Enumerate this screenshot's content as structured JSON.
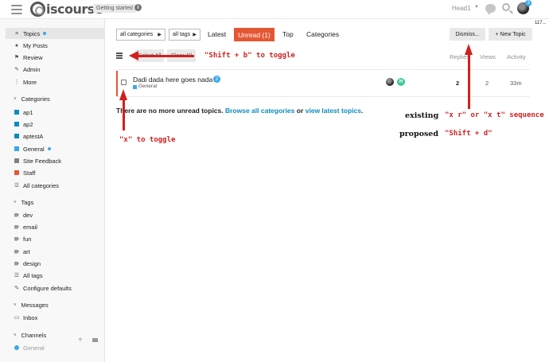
{
  "header": {
    "logo_text": "iscourse",
    "getting_started": "Getting started",
    "info_glyph": "i",
    "user_name": "Head1",
    "notification_count": "3",
    "cutoff_text": "117..."
  },
  "sidebar": {
    "top_items": [
      {
        "label": "Topics",
        "icon": "layers-icon"
      },
      {
        "label": "My Posts",
        "icon": "user-icon"
      },
      {
        "label": "Review",
        "icon": "flag-icon"
      },
      {
        "label": "Admin",
        "icon": "wrench-icon"
      },
      {
        "label": "More",
        "icon": "more-icon"
      }
    ],
    "categories_heading": "Categories",
    "categories": [
      {
        "label": "ap1",
        "color": "#0a8bbf"
      },
      {
        "label": "ap2",
        "color": "#0a8bbf"
      },
      {
        "label": "aptestA",
        "color": "#0a8bbf"
      },
      {
        "label": "General",
        "color": "#3aa8e8"
      },
      {
        "label": "Site Feedback",
        "color": "#808281"
      },
      {
        "label": "Staff",
        "color": "#e45735"
      },
      {
        "label": "All categories",
        "icon": "list-icon"
      }
    ],
    "tags_heading": "Tags",
    "tags": [
      "dev",
      "email",
      "fun",
      "art",
      "design"
    ],
    "all_tags": "All tags",
    "configure_defaults": "Configure defaults",
    "messages_heading": "Messages",
    "inbox": "Inbox",
    "channels_heading": "Channels",
    "channel_general": "General"
  },
  "main": {
    "filter_categories": "all categories",
    "filter_tags": "all tags",
    "nav": {
      "latest": "Latest",
      "unread": "Unread (1)",
      "top": "Top",
      "categories": "Categories"
    },
    "dismiss": "Dismiss...",
    "new_topic": "+ New Topic",
    "select_all": "Select All",
    "clear_all": "Clear All",
    "columns": {
      "replies": "Replies",
      "views": "Views",
      "activity": "Activity"
    },
    "topic": {
      "title": "Dadi dada here goes nada",
      "unread": "2",
      "category": "General",
      "poster2_letter": "H",
      "replies": "2",
      "views": "2",
      "activity": "33m"
    },
    "no_more": "There are no more unread topics. ",
    "browse_all": "Browse all categories",
    "or": " or ",
    "view_latest": "view latest topics",
    "period": "."
  },
  "annotations": {
    "shift_b": "\"Shift + b\" to toggle",
    "x_toggle": "\"x\" to toggle",
    "existing_label": "existing",
    "proposed_label": "proposed",
    "existing_value": "\"x r\" or \"x t\" sequence",
    "proposed_value": "\"Shift + d\""
  }
}
